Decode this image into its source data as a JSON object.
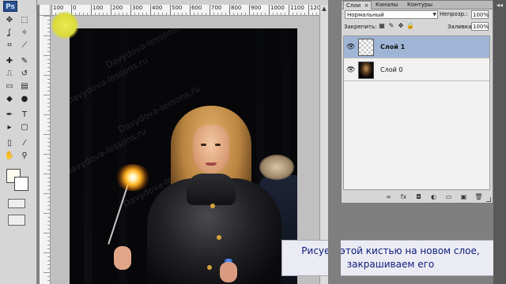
{
  "app": {
    "logo_text": "Ps"
  },
  "tools": [
    {
      "name": "move-tool",
      "glyph": "✥"
    },
    {
      "name": "marquee-tool",
      "glyph": "⬚"
    },
    {
      "name": "lasso-tool",
      "glyph": "ʆ"
    },
    {
      "name": "magic-wand-tool",
      "glyph": "✧"
    },
    {
      "name": "crop-tool",
      "glyph": "⌗"
    },
    {
      "name": "slice-tool",
      "glyph": "⟋"
    },
    {
      "name": "healing-brush-tool",
      "glyph": "✚"
    },
    {
      "name": "brush-tool",
      "glyph": "✎"
    },
    {
      "name": "clone-stamp-tool",
      "glyph": "⎍"
    },
    {
      "name": "history-brush-tool",
      "glyph": "↺"
    },
    {
      "name": "eraser-tool",
      "glyph": "▭"
    },
    {
      "name": "gradient-tool",
      "glyph": "▤"
    },
    {
      "name": "blur-tool",
      "glyph": "◆"
    },
    {
      "name": "dodge-tool",
      "glyph": "●"
    },
    {
      "name": "pen-tool",
      "glyph": "✒"
    },
    {
      "name": "type-tool",
      "glyph": "T"
    },
    {
      "name": "path-selection-tool",
      "glyph": "▸"
    },
    {
      "name": "shape-tool",
      "glyph": "▢"
    },
    {
      "name": "notes-tool",
      "glyph": "▯"
    },
    {
      "name": "eyedropper-tool",
      "glyph": "⁄"
    },
    {
      "name": "hand-tool",
      "glyph": "✋"
    },
    {
      "name": "zoom-tool",
      "glyph": "⚲"
    }
  ],
  "document": {
    "ruler_top_labels": [
      "100",
      "0",
      "100",
      "200",
      "300",
      "400",
      "500",
      "600",
      "700",
      "800",
      "900",
      "1000",
      "1100",
      "120"
    ],
    "watermark": "Davydova-lessons.ru"
  },
  "caption": {
    "line1": "Рисуем этой кистью на новом слое,",
    "line2": "закрашиваем его"
  },
  "layers_panel": {
    "tabs": [
      {
        "label": "Слои",
        "active": true,
        "close": "×"
      },
      {
        "label": "Каналы",
        "active": false
      },
      {
        "label": "Контуры",
        "active": false
      }
    ],
    "blend_mode": "Нормальный",
    "opacity_label": "Непрозр.:",
    "opacity_value": "100%",
    "lock_label": "Закрепить:",
    "fill_label": "Заливка:",
    "fill_value": "100%",
    "layers": [
      {
        "name": "Слой 1",
        "selected": true,
        "thumb": "transparent"
      },
      {
        "name": "Слой 0",
        "selected": false,
        "thumb": "photo"
      }
    ],
    "footer_icons": [
      {
        "name": "link-layers-icon",
        "glyph": "∞"
      },
      {
        "name": "layer-style-icon",
        "glyph": "fx"
      },
      {
        "name": "layer-mask-icon",
        "glyph": "◘"
      },
      {
        "name": "adjustment-layer-icon",
        "glyph": "◐"
      },
      {
        "name": "group-icon",
        "glyph": "▭"
      },
      {
        "name": "new-layer-icon",
        "glyph": "▣"
      },
      {
        "name": "delete-layer-icon",
        "glyph": "🗑"
      }
    ]
  },
  "colors": {
    "caption_text": "#0c1b7a",
    "selected_layer": "#9fb5d5",
    "workspace": "#7f7f7f"
  }
}
